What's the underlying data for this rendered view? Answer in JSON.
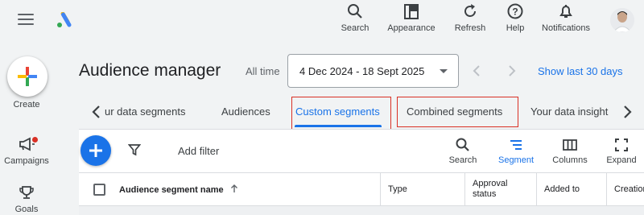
{
  "top_actions": [
    {
      "label": "Search",
      "icon": "search-icon"
    },
    {
      "label": "Appearance",
      "icon": "appearance-icon"
    },
    {
      "label": "Refresh",
      "icon": "refresh-icon"
    },
    {
      "label": "Help",
      "icon": "help-icon"
    },
    {
      "label": "Notifications",
      "icon": "bell-icon"
    }
  ],
  "rail": {
    "create_label": "Create",
    "campaigns_label": "Campaigns",
    "goals_label": "Goals"
  },
  "header": {
    "title": "Audience manager",
    "range_label": "All time",
    "date_range": "4 Dec 2024 - 18 Sept 2025",
    "show_last": "Show last 30 days"
  },
  "tabs": [
    {
      "label": "Your data segments",
      "visible": "ur data segments"
    },
    {
      "label": "Audiences"
    },
    {
      "label": "Custom segments",
      "active": true
    },
    {
      "label": "Combined segments"
    },
    {
      "label": "Your data insights",
      "visible": "Your data insight"
    }
  ],
  "toolbar": {
    "add_filter": "Add filter",
    "tools": [
      {
        "label": "Search",
        "icon": "search-icon"
      },
      {
        "label": "Segment",
        "icon": "segment-icon",
        "active": true
      },
      {
        "label": "Columns",
        "icon": "columns-icon"
      },
      {
        "label": "Expand",
        "icon": "expand-icon"
      }
    ]
  },
  "table": {
    "columns": [
      {
        "label": "Audience segment name"
      },
      {
        "label": "Type"
      },
      {
        "label": "Approval",
        "label2": "status"
      },
      {
        "label": "Added to"
      },
      {
        "label": "Creation"
      }
    ]
  },
  "colors": {
    "accent": "#1a73e8",
    "highlight": "#d93025",
    "background": "#f1f3f4"
  }
}
